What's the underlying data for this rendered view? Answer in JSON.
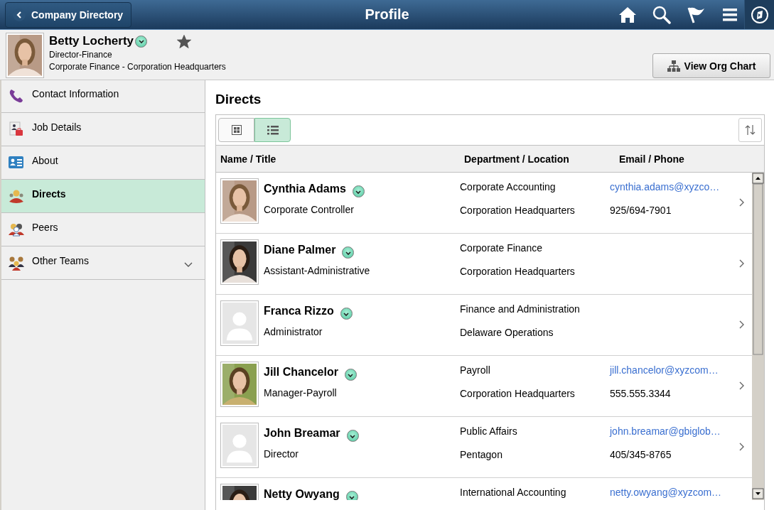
{
  "header": {
    "back_button": "Company Directory",
    "title": "Profile"
  },
  "profile": {
    "name": "Betty Locherty",
    "favorite": true,
    "job_title": "Director-Finance",
    "department": "Corporate Finance - Corporation Headquarters",
    "org_chart_button": "View Org Chart"
  },
  "sidebar": {
    "items": [
      {
        "label": "Contact Information",
        "kind": "page",
        "selected": false
      },
      {
        "label": "Job Details",
        "kind": "page",
        "selected": false
      },
      {
        "label": "About",
        "kind": "page",
        "selected": false
      },
      {
        "label": "Directs",
        "kind": "page",
        "selected": true
      },
      {
        "label": "Peers",
        "kind": "page",
        "selected": false
      },
      {
        "label": "Other Teams",
        "kind": "group",
        "selected": false,
        "expanded": false
      }
    ]
  },
  "directs": {
    "heading": "Directs",
    "view_toggle": [
      {
        "kind": "grid",
        "selected": false
      },
      {
        "kind": "list",
        "selected": true
      }
    ],
    "columns": [
      "Name / Title",
      "Department / Location",
      "Email / Phone"
    ],
    "rows": [
      {
        "name": "Cynthia Adams",
        "title": "Corporate Controller",
        "department": "Corporate Accounting",
        "location": "Corporation Headquarters",
        "email": "cynthia.adams@xyzco…",
        "phone": "925/694-7901"
      },
      {
        "name": "Diane Palmer",
        "title": "Assistant-Administrative",
        "department": "Corporate Finance",
        "location": "Corporation Headquarters"
      },
      {
        "avatar": {
          "kind": "placeholder"
        },
        "name": "Franca Rizzo",
        "title": "Administrator",
        "department": "Finance and Administration",
        "location": "Delaware Operations"
      },
      {
        "name": "Jill Chancelor",
        "title": "Manager-Payroll",
        "department": "Payroll",
        "location": "Corporation Headquarters",
        "email": "jill.chancelor@xyzcom…",
        "phone": "555.555.3344"
      },
      {
        "avatar": {
          "kind": "placeholder"
        },
        "name": "John Breamar",
        "title": "Director",
        "department": "Public Affairs",
        "location": "Pentagon",
        "email": "john.breamar@gbiglob…",
        "phone": "405/345-8765"
      },
      {
        "name": "Netty Owyang",
        "department": "International Accounting",
        "email": "netty.owyang@xyzcom…"
      }
    ]
  }
}
